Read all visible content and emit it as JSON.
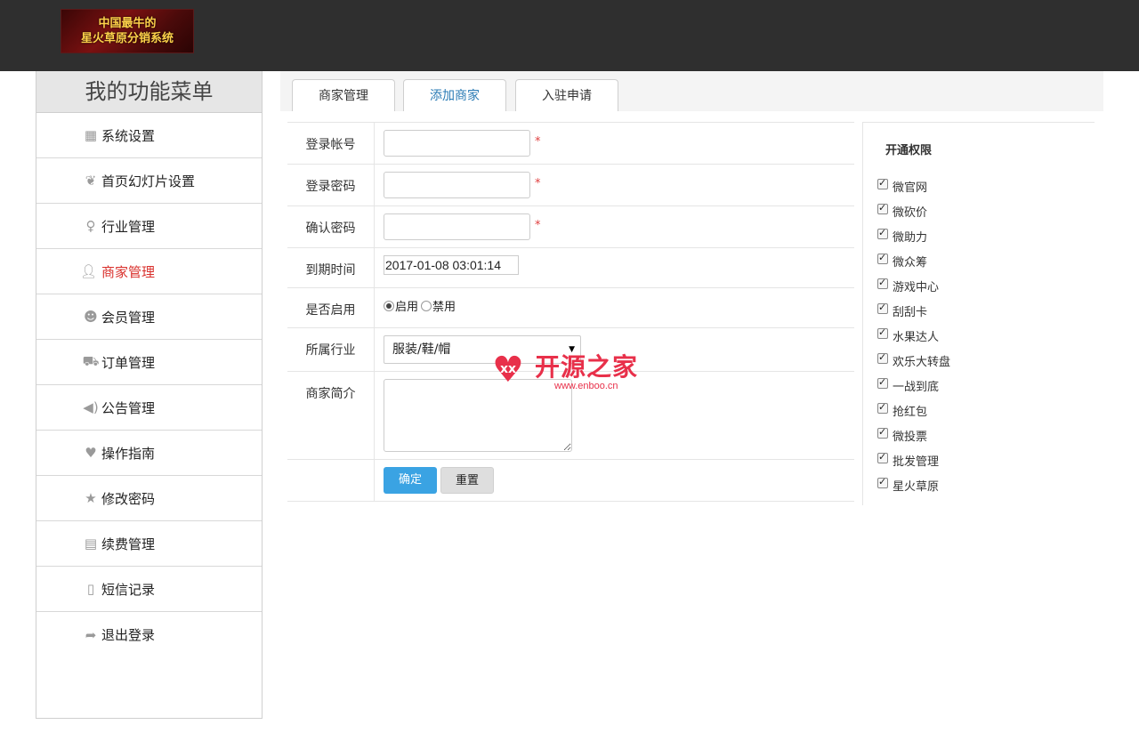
{
  "header": {
    "logo_line1": "中国最牛的",
    "logo_line2": "星火草原分销系统",
    "logo_bg_color": "#7a1111",
    "bar_color": "#2f2f2f"
  },
  "sidebar": {
    "title": "我的功能菜单",
    "items": [
      {
        "label": "系统设置",
        "icon": "store-icon",
        "active": false
      },
      {
        "label": "首页幻灯片设置",
        "icon": "slides-icon",
        "active": false
      },
      {
        "label": "行业管理",
        "icon": "key-icon",
        "active": false
      },
      {
        "label": "商家管理",
        "icon": "user-star-icon",
        "active": true
      },
      {
        "label": "会员管理",
        "icon": "users-icon",
        "active": false
      },
      {
        "label": "订单管理",
        "icon": "cart-icon",
        "active": false
      },
      {
        "label": "公告管理",
        "icon": "speaker-icon",
        "active": false
      },
      {
        "label": "操作指南",
        "icon": "heart-icon",
        "active": false
      },
      {
        "label": "修改密码",
        "icon": "star-icon",
        "active": false
      },
      {
        "label": "续费管理",
        "icon": "book-icon",
        "active": false
      },
      {
        "label": "短信记录",
        "icon": "phone-icon",
        "active": false
      },
      {
        "label": "退出登录",
        "icon": "share-arrow-icon",
        "active": false
      }
    ]
  },
  "tabs": [
    {
      "label": "商家管理",
      "active": false
    },
    {
      "label": "添加商家",
      "active": true
    },
    {
      "label": "入驻申请",
      "active": false
    }
  ],
  "form": {
    "account_label": "登录帐号",
    "account_value": "",
    "password_label": "登录密码",
    "password_value": "",
    "confirm_label": "确认密码",
    "confirm_value": "",
    "required_mark": "*",
    "expire_label": "到期时间",
    "expire_value": "2017-01-08 03:01:14",
    "enable_label": "是否启用",
    "enable_on": "启用",
    "enable_off": "禁用",
    "enable_selected": "启用",
    "industry_label": "所属行业",
    "industry_value": "服装/鞋/帽",
    "intro_label": "商家简介",
    "intro_value": "",
    "submit_label": "确定",
    "reset_label": "重置"
  },
  "permissions": {
    "title": "开通权限",
    "items": [
      {
        "label": "微官网",
        "checked": true
      },
      {
        "label": "微砍价",
        "checked": true
      },
      {
        "label": "微助力",
        "checked": true
      },
      {
        "label": "微众筹",
        "checked": true
      },
      {
        "label": "游戏中心",
        "checked": true
      },
      {
        "label": "刮刮卡",
        "checked": true
      },
      {
        "label": "水果达人",
        "checked": true
      },
      {
        "label": "欢乐大转盘",
        "checked": true
      },
      {
        "label": "一战到底",
        "checked": true
      },
      {
        "label": "抢红包",
        "checked": true
      },
      {
        "label": "微投票",
        "checked": true
      },
      {
        "label": "批发管理",
        "checked": true
      },
      {
        "label": "星火草原",
        "checked": true
      }
    ]
  },
  "watermark": {
    "text": "开源之家",
    "url": "www.enboo.cn",
    "color": "#e8304a"
  },
  "colors": {
    "accent_button": "#3aa3e3",
    "active_menu": "#d9302c",
    "active_tab": "#2a7bb5",
    "required": "#e04040"
  }
}
